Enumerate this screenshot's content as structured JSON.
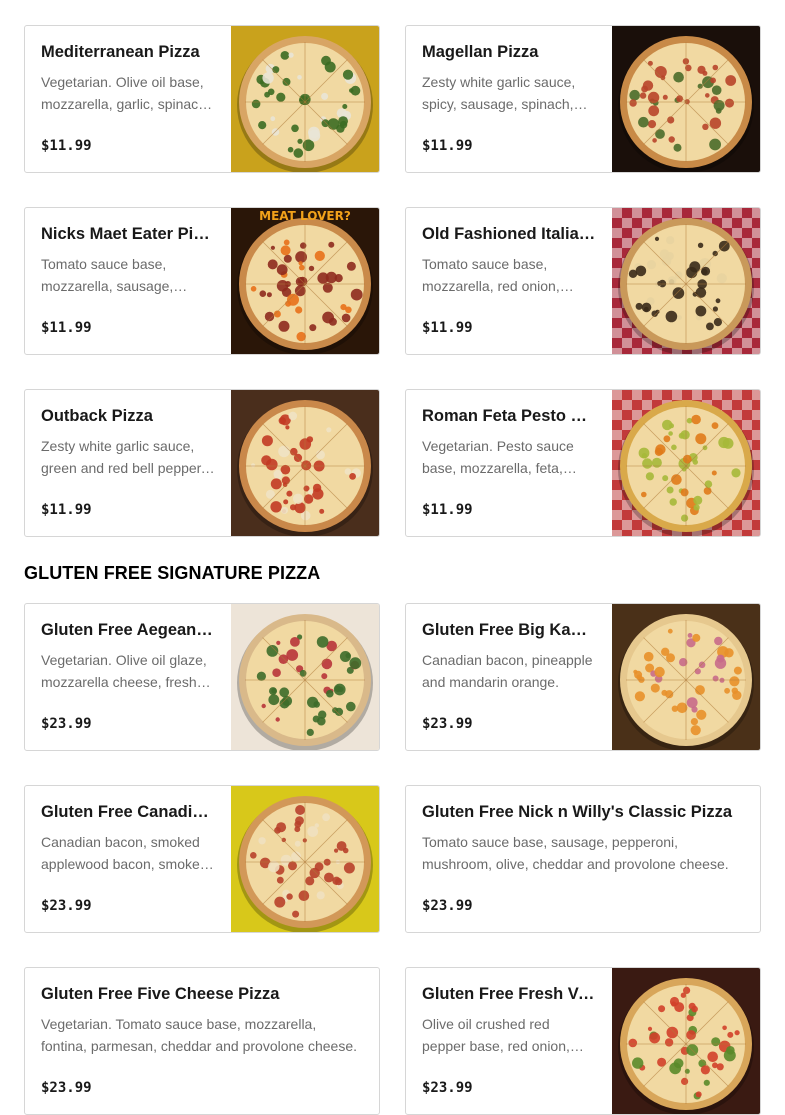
{
  "section_heading": "GLUTEN FREE SIGNATURE PIZZA",
  "items": [
    {
      "name": "Mediterranean Pizza",
      "description": "Vegetarian. Olive oil base, mozzarella, garlic, spinach, tomato, feta.",
      "price": "$11.99",
      "photo": "mediterranean-pizza-photo",
      "bg": "#c9a21c",
      "crust": "#d8a564",
      "topping": "#3c6b22",
      "accent": "#e9e4d6",
      "sign": ""
    },
    {
      "name": "Magellan Pizza",
      "description": "Zesty white garlic sauce, spicy, sausage, spinach, tomato, mushroom.",
      "price": "$11.99",
      "photo": "magellan-pizza-photo",
      "bg": "#1a0f0a",
      "crust": "#c88a47",
      "topping": "#b8442a",
      "accent": "#4a6b2a",
      "sign": ""
    },
    {
      "name": "Nicks Maet Eater Pizza",
      "description": "Tomato sauce base, mozzarella, sausage, pepperoni, bacon, ham.",
      "price": "$11.99",
      "photo": "meat-eater-pizza-photo",
      "bg": "#2a1608",
      "crust": "#c98a4a",
      "topping": "#8e2a1e",
      "accent": "#e8701a",
      "sign": "MEAT LOVER?"
    },
    {
      "name": "Old Fashioned Italian Pizza",
      "description": "Tomato sauce base, mozzarella, red onion, sausage, mushroom.",
      "price": "$11.99",
      "photo": "old-fashioned-pizza-photo",
      "bg": "#a8283a",
      "crust": "#c9995a",
      "topping": "#3a2a1a",
      "accent": "#e8d3a0",
      "sign": ""
    },
    {
      "name": "Outback Pizza",
      "description": "Zesty white garlic sauce, green and red bell pepper, chicken, onion.",
      "price": "$11.99",
      "photo": "outback-pizza-photo",
      "bg": "#4a2e1c",
      "crust": "#c9884a",
      "topping": "#c23a24",
      "accent": "#f0e2c4",
      "sign": ""
    },
    {
      "name": "Roman Feta Pesto Pizza",
      "description": "Vegetarian. Pesto sauce base, mozzarella, feta, tomato, artichoke.",
      "price": "$11.99",
      "photo": "roman-feta-pesto-pizza-photo",
      "bg": "#c23a3a",
      "crust": "#d9a94a",
      "topping": "#a6b83a",
      "accent": "#e07a1a",
      "sign": ""
    },
    {
      "name": "Gluten Free Aegean Pizza",
      "description": "Vegetarian. Olive oil glaze, mozzarella cheese, fresh spinach, tomato.",
      "price": "$23.99",
      "photo": "gf-aegean-pizza-photo",
      "bg": "#ede4d8",
      "crust": "#d9b98a",
      "topping": "#3d6b2a",
      "accent": "#b8343a",
      "sign": ""
    },
    {
      "name": "Gluten Free Big Kahuna Pizza",
      "description": "Canadian bacon, pineapple and mandarin orange.",
      "price": "$23.99",
      "photo": "gf-big-kahuna-pizza-photo",
      "bg": "#4a3018",
      "crust": "#e6c88e",
      "topping": "#e8902a",
      "accent": "#c86a8a",
      "sign": ""
    },
    {
      "name": "Gluten Free Canadian Pizza",
      "description": "Canadian bacon, smoked applewood bacon, smoked ham.",
      "price": "$23.99",
      "photo": "gf-canadian-pizza-photo",
      "bg": "#d8c81a",
      "crust": "#d29858",
      "topping": "#b8402a",
      "accent": "#f0e0c0",
      "sign": ""
    },
    {
      "name": "Gluten Free Nick n Willy's Classic Pizza",
      "description": "Tomato sauce base, sausage, pepperoni, mushroom, olive, cheddar and provolone cheese.",
      "price": "$23.99",
      "photo": "",
      "bg": "",
      "crust": "",
      "topping": "",
      "accent": "",
      "sign": ""
    },
    {
      "name": "Gluten Free Five Cheese Pizza",
      "description": "Vegetarian. Tomato sauce base, mozzarella, fontina, parmesan, cheddar and provolone cheese.",
      "price": "$23.99",
      "photo": "",
      "bg": "",
      "crust": "",
      "topping": "",
      "accent": "",
      "sign": ""
    },
    {
      "name": "Gluten Free Fresh Veggie Pizza",
      "description": "Olive oil crushed red pepper base, red onion, green pepper, tomato.",
      "price": "$23.99",
      "photo": "gf-fresh-veggie-pizza-photo",
      "bg": "#3a1a12",
      "crust": "#d8a65a",
      "topping": "#d2402a",
      "accent": "#5a8a2a",
      "sign": ""
    }
  ]
}
